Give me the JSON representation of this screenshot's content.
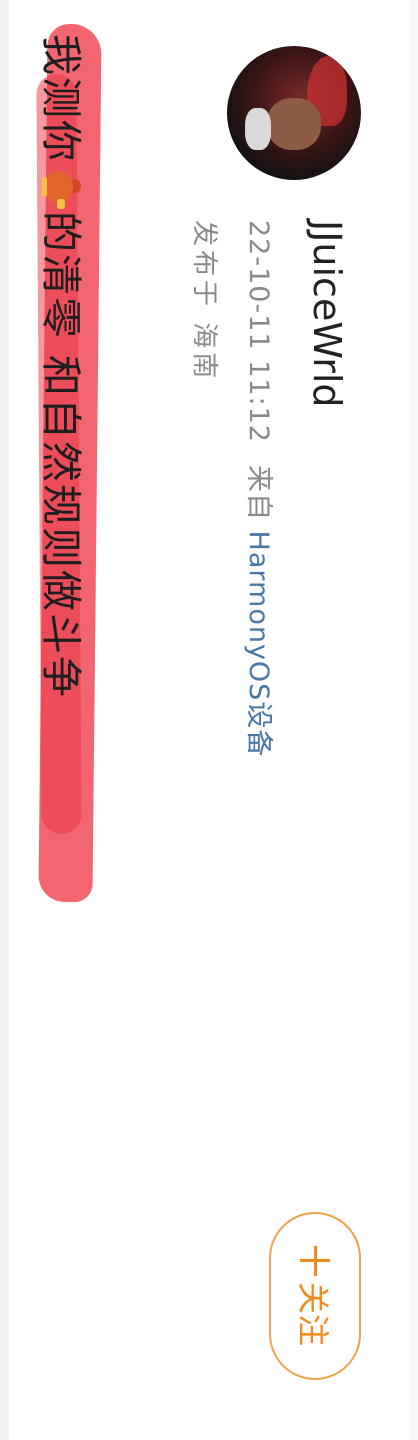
{
  "post": {
    "author": {
      "name": "JJuiceWrld",
      "avatar_icon": "avatar-photo"
    },
    "timestamp": "22-10-11 11:12",
    "source_prefix": "来自",
    "source_device": "HarmonyOS设备",
    "location": "发布于 海南",
    "follow_label": "关注",
    "follow_icon": "plus-icon",
    "content_part1": "我测你",
    "content_emoji": "rooster-emoji",
    "content_part2": "的清零 和自然规则做斗争",
    "highlight_color": "#ef3b48",
    "accent_color": "#f08a1f",
    "link_color": "#4a78a6"
  }
}
